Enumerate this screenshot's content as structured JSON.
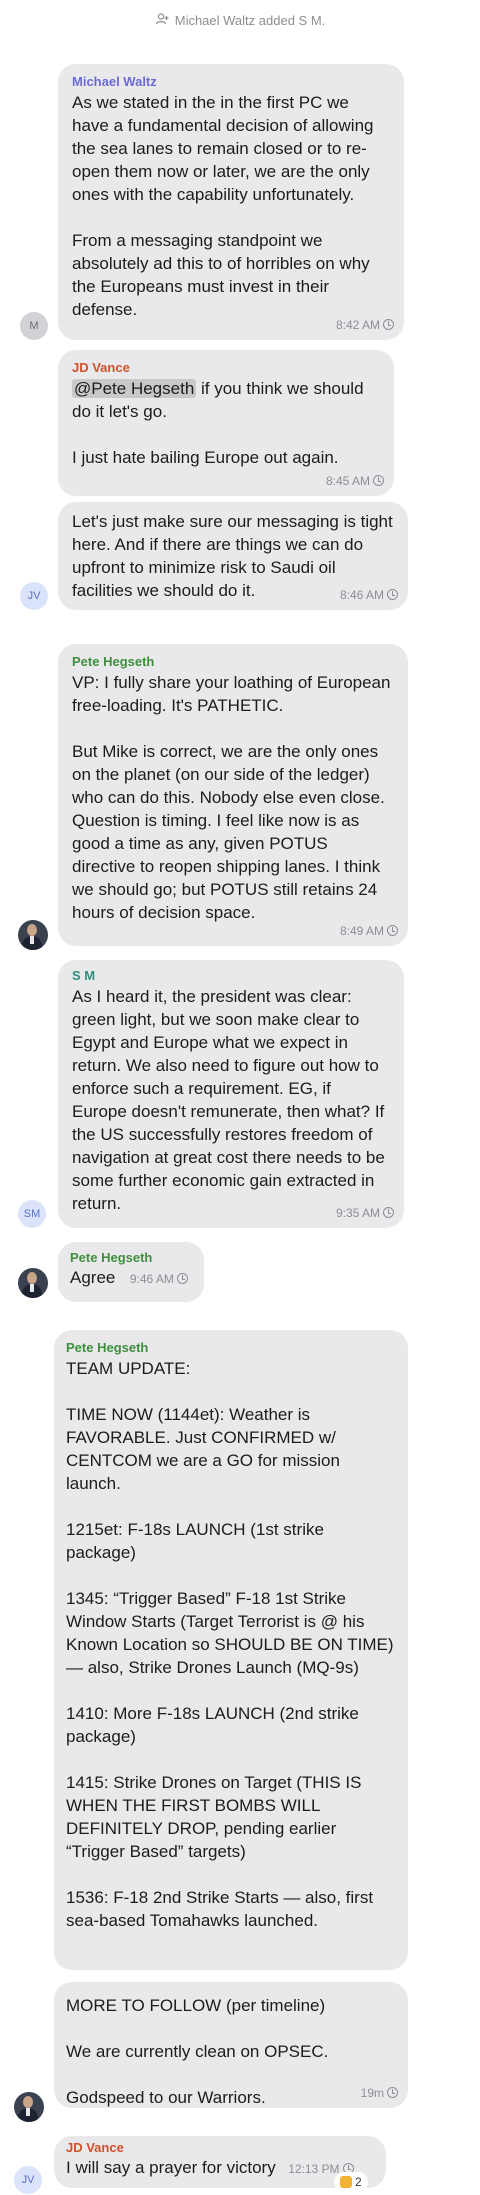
{
  "system_message": "Michael Waltz added S M.",
  "colors": {
    "bubble": "#e9e9eb",
    "michael_waltz": "#6b6bd6",
    "jd_vance": "#d1512a",
    "pete_hegseth": "#3f8f3f",
    "sm": "#2f8f7f",
    "meta": "#8e8e93"
  },
  "messages": [
    {
      "sender": "Michael Waltz",
      "text": "As we stated in the in the first PC we have a fundamental decision of allowing the sea lanes to remain closed or to re-open them now or later, we are the only ones with the capability unfortunately.\n\nFrom a messaging standpoint we absolutely ad this to of horribles on why the Europeans must invest in their defense.",
      "time": "8:42 AM",
      "avatar": "M"
    },
    {
      "sender": "JD Vance",
      "mention": "@Pete Hegseth",
      "text": " if you think we should do it let's go.\n\nI just hate bailing Europe out again.",
      "time": "8:45 AM"
    },
    {
      "text": "Let's just make sure our messaging is tight here. And if there are things we can do upfront to minimize risk to Saudi oil facilities we should do it.",
      "time": "8:46 AM",
      "avatar": "JV"
    },
    {
      "sender": "Pete Hegseth",
      "text": "VP: I fully share your loathing of European free-loading. It's PATHETIC.\n\nBut Mike is correct, we are the only ones on the planet (on our side of the ledger) who can do this. Nobody else even close. Question is timing. I feel like now is as good a time as any, given POTUS directive to reopen shipping lanes. I think we should go; but POTUS still retains 24 hours of decision space.",
      "time": "8:49 AM"
    },
    {
      "sender": "S M",
      "text": "As I heard it, the president was clear: green light, but we soon make clear to Egypt and Europe what we expect in return. We also need to figure out how to enforce such a requirement. EG, if Europe doesn't remunerate, then what? If the US successfully restores freedom of navigation at great cost there needs to be some further economic gain extracted in return.",
      "time": "9:35 AM",
      "avatar": "SM"
    },
    {
      "sender": "Pete Hegseth",
      "text": "Agree",
      "time": "9:46 AM"
    },
    {
      "sender": "Pete Hegseth",
      "text": "TEAM UPDATE:\n\nTIME NOW (1144et): Weather is FAVORABLE. Just CONFIRMED w/ CENTCOM we are a GO for mission launch.\n\n1215et: F-18s LAUNCH (1st strike package)\n\n1345: “Trigger Based” F-18 1st Strike Window Starts (Target Terrorist is @ his Known Location so SHOULD BE ON TIME) — also, Strike Drones Launch (MQ-9s)\n\n1410: More F-18s LAUNCH (2nd strike package)\n\n1415: Strike Drones on Target (THIS IS WHEN THE FIRST BOMBS WILL DEFINITELY DROP, pending earlier “Trigger Based” targets)\n\n1536: F-18 2nd Strike Starts — also, first sea-based Tomahawks launched."
    },
    {
      "text": "MORE TO FOLLOW (per timeline)\n\nWe are currently clean on OPSEC.\n\nGodspeed to our Warriors.",
      "time": "19m"
    },
    {
      "sender": "JD Vance",
      "text": "I will say a prayer for victory",
      "time": "12:13 PM",
      "avatar": "JV",
      "reaction_count": "2"
    }
  ]
}
